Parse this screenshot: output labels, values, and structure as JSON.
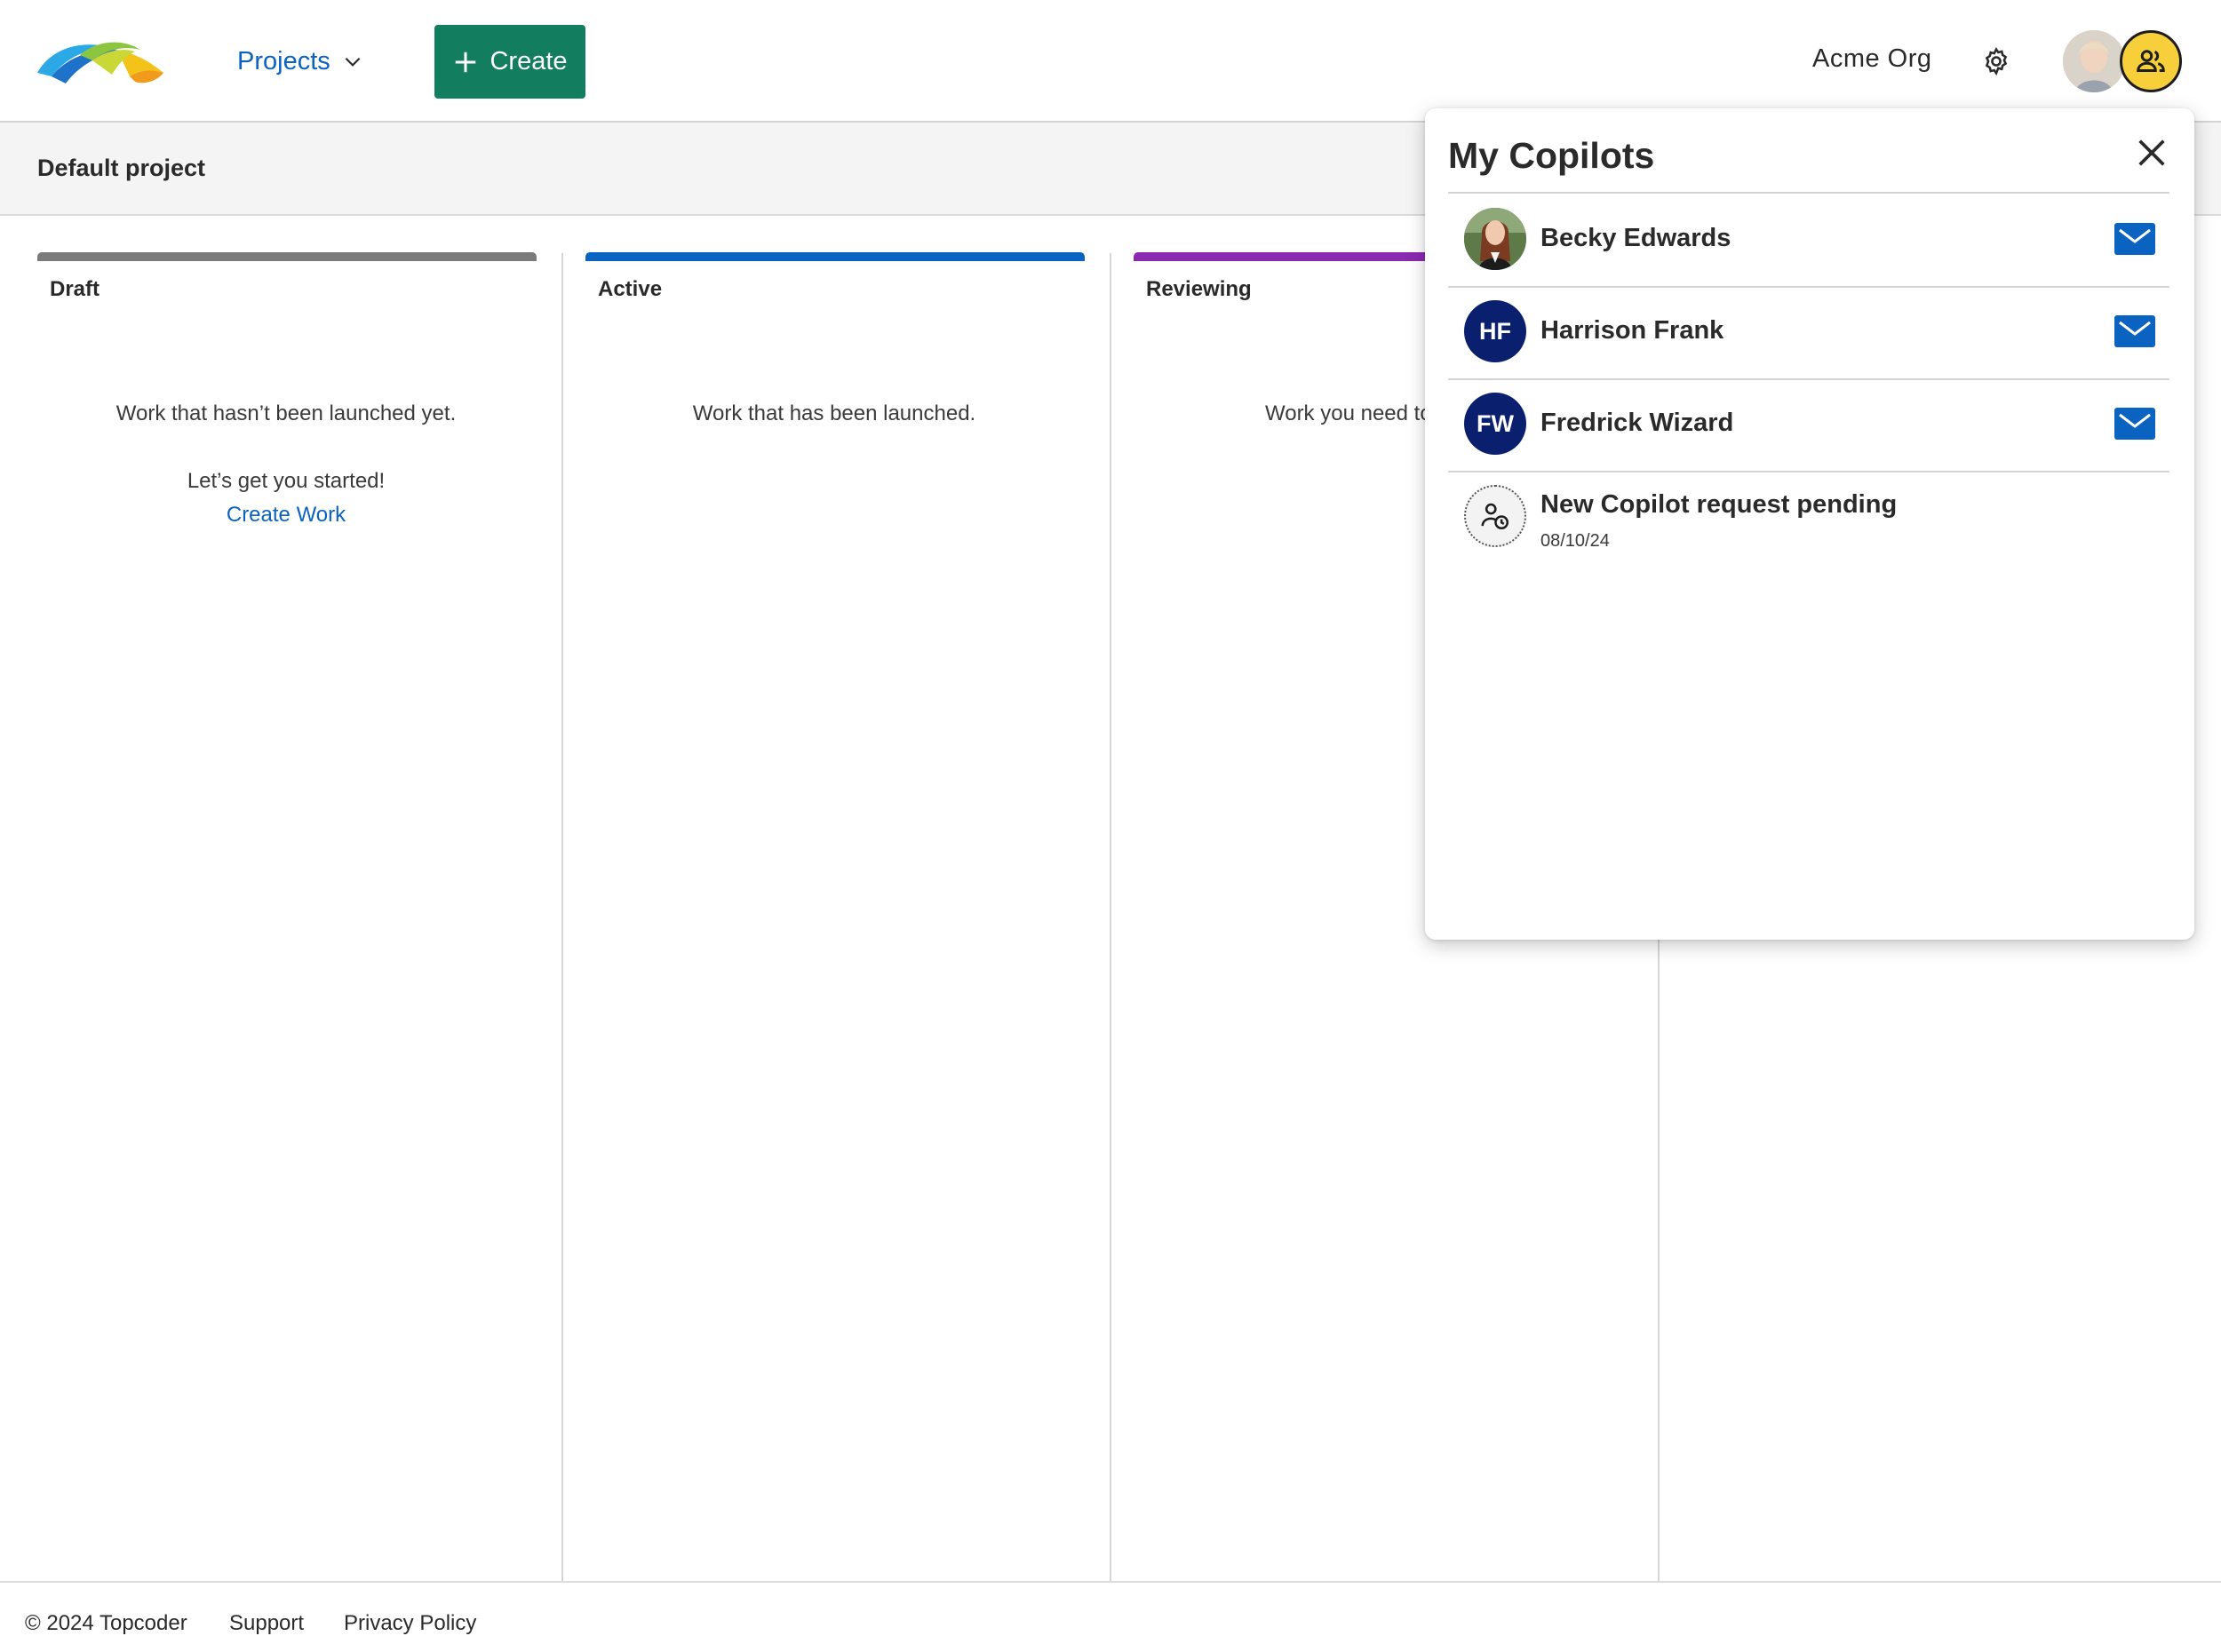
{
  "header": {
    "projects_label": "Projects",
    "create_label": "Create",
    "org_name": "Acme Org"
  },
  "project": {
    "title": "Default project"
  },
  "columns": [
    {
      "title": "Draft",
      "description": "Work that hasn’t been launched yet.",
      "prompt": "Let’s get you started!",
      "link": "Create Work",
      "color": "#7a7a7a"
    },
    {
      "title": "Active",
      "description": "Work that has been launched.",
      "color": "#0b63c1"
    },
    {
      "title": "Reviewing",
      "description": "Work you need to",
      "color": "#8a2ab0"
    }
  ],
  "copilots_panel": {
    "title": "My Copilots",
    "copilots": [
      {
        "name": "Becky Edwards",
        "initials": "",
        "icon": "mail-icon"
      },
      {
        "name": "Harrison Frank",
        "initials": "HF",
        "icon": "mail-icon"
      },
      {
        "name": "Fredrick Wizard",
        "initials": "FW",
        "icon": "mail-icon"
      }
    ],
    "pending": {
      "label": "New Copilot request pending",
      "date": "08/10/24",
      "icon": "user-clock-icon"
    }
  },
  "footer": {
    "copyright": "© 2024 Topcoder",
    "support": "Support",
    "privacy": "Privacy Policy"
  },
  "colors": {
    "brand_green": "#137d60",
    "link_blue": "#0b63c1",
    "initials_navy": "#0a1f6e",
    "copilot_yellow": "#f6cf3a"
  }
}
